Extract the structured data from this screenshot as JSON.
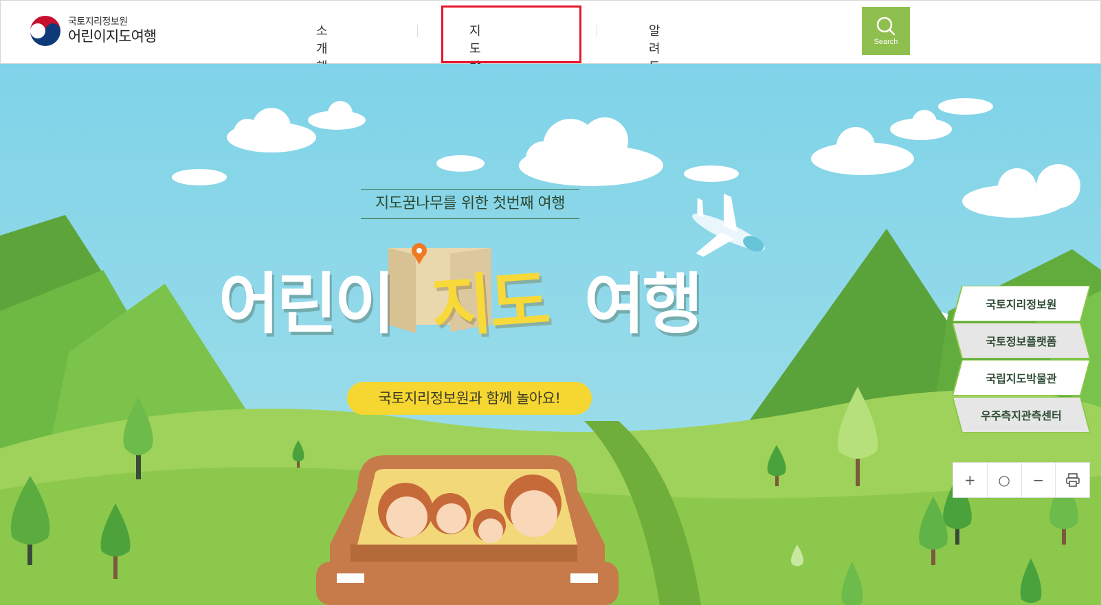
{
  "header": {
    "logo_sub": "국토지리정보원",
    "logo_main": "어린이지도여행",
    "nav": [
      {
        "label": "소개해요"
      },
      {
        "label": "지도랑 놀아요"
      },
      {
        "label": "알려드려요"
      }
    ],
    "search_label": "Search"
  },
  "hero": {
    "tagline": "지도꿈나무를 위한 첫번째 여행",
    "title_part1": "어린이",
    "title_part2": "지도",
    "title_part3": "여행",
    "pill": "국토지리정보원과 함께 놀아요!"
  },
  "side_links": [
    {
      "label": "국토지리정보원"
    },
    {
      "label": "국토정보플랫폼"
    },
    {
      "label": "국립지도박물관"
    },
    {
      "label": "우주측지관측센터"
    }
  ],
  "tools": {
    "zoom_in": "+",
    "reset": "○",
    "zoom_out": "−",
    "print_icon": "print-icon"
  },
  "colors": {
    "highlight": "#e8162b",
    "search_bg": "#8fbf4e",
    "sky": "#8fd6e6",
    "pill": "#f6d630",
    "title_yellow": "#f8d93a"
  }
}
